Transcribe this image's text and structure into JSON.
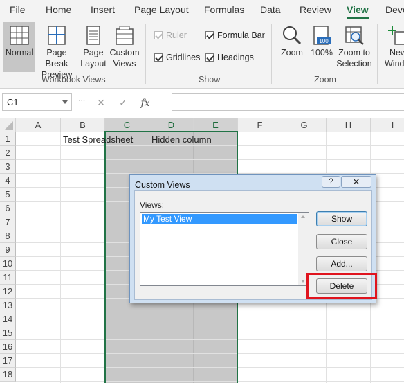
{
  "ribbon_tabs": [
    "File",
    "Home",
    "Insert",
    "Page Layout",
    "Formulas",
    "Data",
    "Review",
    "View",
    "Deve"
  ],
  "active_tab": "View",
  "workbook_views": {
    "normal": "Normal",
    "page_break": [
      "Page Break",
      "Preview"
    ],
    "page_layout": [
      "Page",
      "Layout"
    ],
    "custom_views": [
      "Custom",
      "Views"
    ],
    "group_label": "Workbook Views"
  },
  "show": {
    "ruler": "Ruler",
    "gridlines": "Gridlines",
    "formula_bar": "Formula Bar",
    "headings": "Headings",
    "group_label": "Show"
  },
  "zoom": {
    "zoom": "Zoom",
    "zoom100": "100%",
    "zoom100_icon_text": "100",
    "zoom_to_selection": [
      "Zoom to",
      "Selection"
    ],
    "group_label": "Zoom"
  },
  "window": {
    "new_window": [
      "New",
      "Wind"
    ]
  },
  "formula_bar": {
    "name_box": "C1",
    "fx": "fx"
  },
  "columns": [
    "A",
    "B",
    "C",
    "D",
    "E",
    "F",
    "G",
    "H",
    "I"
  ],
  "rows": [
    "1",
    "2",
    "3",
    "4",
    "5",
    "6",
    "7",
    "8",
    "9",
    "10",
    "11",
    "12",
    "13",
    "14",
    "15",
    "16",
    "17",
    "18"
  ],
  "cells": {
    "B1": "Test Spreadsheet",
    "D1": "Hidden column"
  },
  "dialog": {
    "title": "Custom Views",
    "help": "?",
    "close": "✕",
    "views_label": "Views:",
    "views": [
      "My Test View"
    ],
    "buttons": {
      "show": "Show",
      "close": "Close",
      "add": "Add...",
      "delete": "Delete"
    }
  },
  "colors": {
    "excel_green": "#217346",
    "highlight_red": "#e0141e",
    "selection_blue": "#3399ff"
  }
}
